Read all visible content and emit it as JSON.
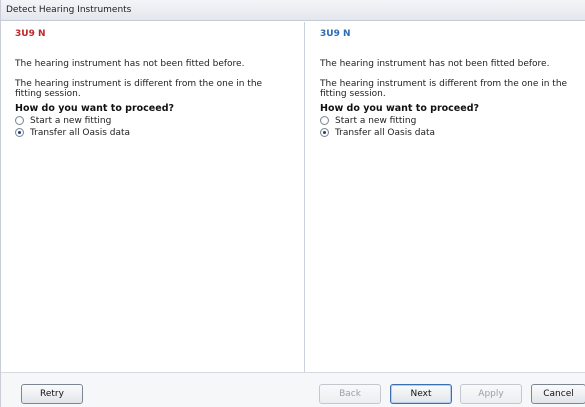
{
  "window": {
    "title": "Detect Hearing Instruments"
  },
  "left_panel": {
    "device": "3U9 N",
    "msg1": "The hearing instrument has not been fitted before.",
    "msg2": "The hearing instrument is different from the one in the fitting session.",
    "question": "How do you want to proceed?",
    "options": [
      {
        "label": "Start a new fitting",
        "selected": false
      },
      {
        "label": "Transfer all Oasis data",
        "selected": true
      }
    ]
  },
  "right_panel": {
    "device": "3U9 N",
    "msg1": "The hearing instrument has not been fitted before.",
    "msg2": "The hearing instrument is different from the one in the fitting session.",
    "question": "How do you want to proceed?",
    "options": [
      {
        "label": "Start a new fitting",
        "selected": false
      },
      {
        "label": "Transfer all Oasis data",
        "selected": true
      }
    ]
  },
  "buttons": {
    "retry": "Retry",
    "back": "Back",
    "next": "Next",
    "apply": "Apply",
    "cancel": "Cancel"
  },
  "colors": {
    "left_device": "#c0262c",
    "right_device": "#2a6cb5"
  }
}
